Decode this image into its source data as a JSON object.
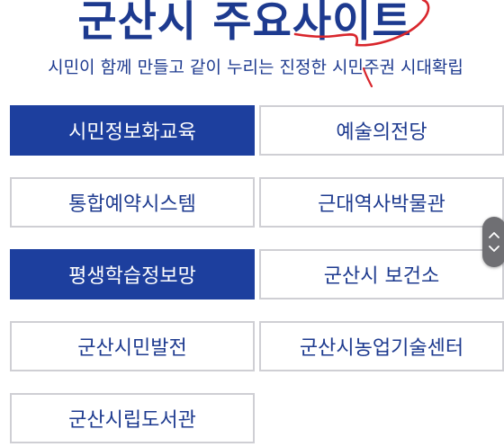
{
  "header": {
    "title": "군산시 주요사이트",
    "subtitle": "시민이 함께 만들고 같이 누리는 진정한 시민주권 시대확립"
  },
  "sites": [
    {
      "label": "시민정보화교육",
      "style": "primary"
    },
    {
      "label": "예술의전당",
      "style": "outline"
    },
    {
      "label": "통합예약시스템",
      "style": "outline"
    },
    {
      "label": "근대역사박물관",
      "style": "outline"
    },
    {
      "label": "평생학습정보망",
      "style": "primary"
    },
    {
      "label": "군산시 보건소",
      "style": "outline"
    },
    {
      "label": "군산시민발전",
      "style": "outline"
    },
    {
      "label": "군산시농업기술센터",
      "style": "outline"
    },
    {
      "label": "군산시립도서관",
      "style": "outline"
    }
  ],
  "scroll_control": {
    "up_icon": "chevron-up-icon",
    "down_icon": "chevron-down-icon"
  },
  "colors": {
    "primary": "#1d3f9e",
    "text": "#1d3a8f",
    "border": "#cfcfd4",
    "scribble": "#d9262c"
  }
}
